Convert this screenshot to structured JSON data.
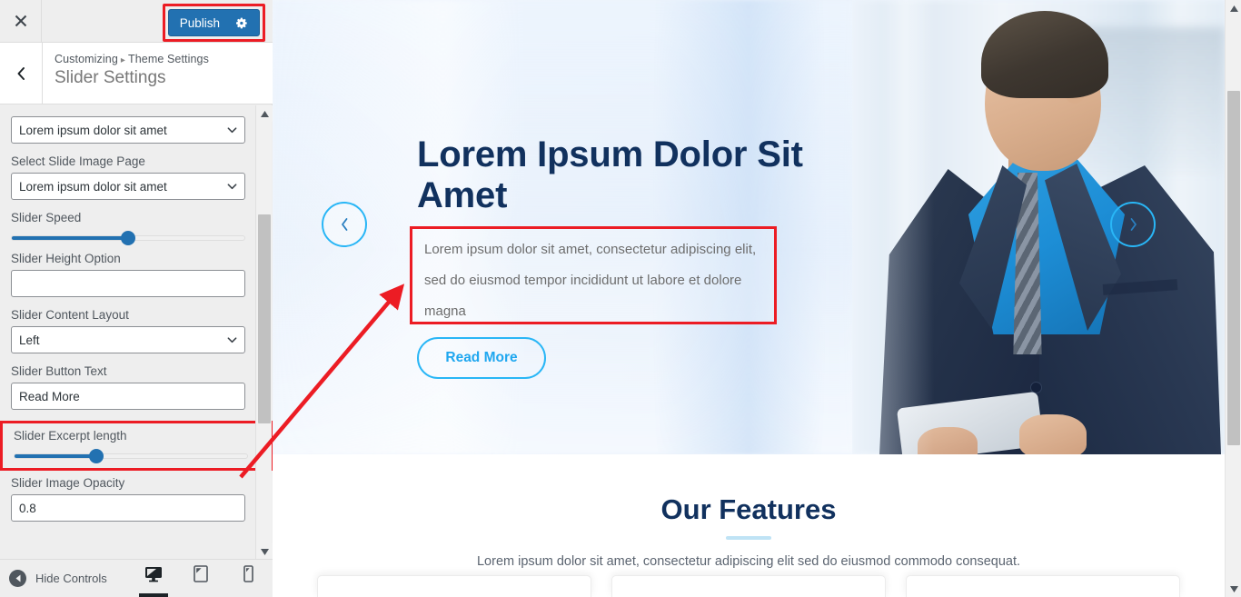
{
  "customizer": {
    "close_icon": "close-icon",
    "publish_label": "Publish",
    "publish_gear_icon": "gear-icon",
    "back_icon": "chevron-left-icon",
    "breadcrumb_root": "Customizing",
    "breadcrumb_sep": "▸",
    "breadcrumb_parent": "Theme Settings",
    "panel_title": "Slider Settings",
    "accent_blue": "#2271b1",
    "annotation_red": "#ec1c24"
  },
  "controls": [
    {
      "type": "select",
      "label": "",
      "value": "Lorem ipsum dolor sit amet",
      "name": "select-slide-page"
    },
    {
      "type": "select",
      "label": "Select Slide Image Page",
      "value": "Lorem ipsum dolor sit amet",
      "name": "select-slide-image-page"
    },
    {
      "type": "slider",
      "label": "Slider Speed",
      "percent": 50,
      "name": "slider-speed"
    },
    {
      "type": "text",
      "label": "Slider Height Option",
      "value": "",
      "name": "slider-height-option"
    },
    {
      "type": "select",
      "label": "Slider Content Layout",
      "value": "Left",
      "name": "slider-content-layout"
    },
    {
      "type": "text",
      "label": "Slider Button Text",
      "value": "Read More",
      "name": "slider-button-text"
    },
    {
      "type": "slider",
      "label": "Slider Excerpt length",
      "percent": 35,
      "name": "slider-excerpt-length",
      "highlighted": true
    },
    {
      "type": "text",
      "label": "Slider Image Opacity",
      "value": "0.8",
      "name": "slider-image-opacity"
    }
  ],
  "footer": {
    "hide_controls_label": "Hide Controls",
    "hide_icon": "collapse-left-icon",
    "devices": [
      {
        "label": "Desktop",
        "icon": "desktop-icon",
        "active": true
      },
      {
        "label": "Tablet",
        "icon": "tablet-icon",
        "active": false
      },
      {
        "label": "Mobile",
        "icon": "mobile-icon",
        "active": false
      }
    ]
  },
  "preview": {
    "hero": {
      "title": "Lorem Ipsum Dolor Sit Amet",
      "excerpt": "Lorem ipsum dolor sit amet, consectetur adipiscing elit, sed do eiusmod tempor incididunt ut labore et dolore magna",
      "button_label": "Read More",
      "prev_icon": "chevron-left-icon",
      "next_icon": "chevron-right-icon",
      "title_color": "#11315e",
      "accent_cyan": "#29b6f6"
    },
    "features": {
      "title": "Our Features",
      "subtitle": "Lorem ipsum dolor sit amet, consectetur adipiscing elit sed do eiusmod commodo consequat.",
      "card_count": 3
    }
  }
}
